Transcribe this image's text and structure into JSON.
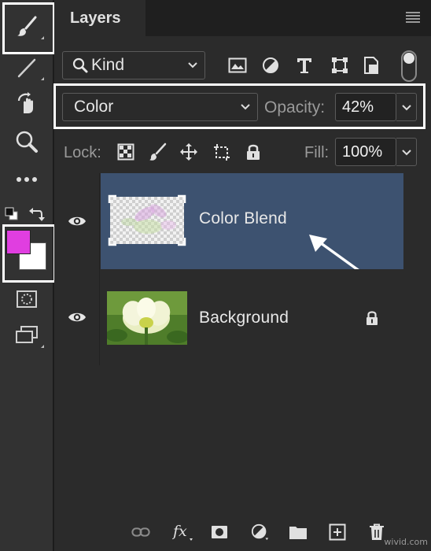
{
  "panel": {
    "tab_label": "Layers"
  },
  "filter": {
    "kind_label": "Kind",
    "icons": [
      "pixel-filter-icon",
      "adjustment-filter-icon",
      "type-filter-icon",
      "shape-filter-icon",
      "smart-object-filter-icon"
    ]
  },
  "blend": {
    "mode": "Color",
    "opacity_label": "Opacity:",
    "opacity_value": "42%"
  },
  "lock_row": {
    "lock_label": "Lock:",
    "fill_label": "Fill:",
    "fill_value": "100%"
  },
  "layers": [
    {
      "name": "Color Blend",
      "selected": true,
      "visible": true,
      "locked": false
    },
    {
      "name": "Background",
      "selected": false,
      "visible": true,
      "locked": true
    }
  ],
  "colors": {
    "foreground": "#e03ee0",
    "background": "#ffffff",
    "selected_row": "#3d5270",
    "panel_bg": "#2b2b2b",
    "highlight_box": "#ffffff"
  },
  "watermark": "wivid.com"
}
